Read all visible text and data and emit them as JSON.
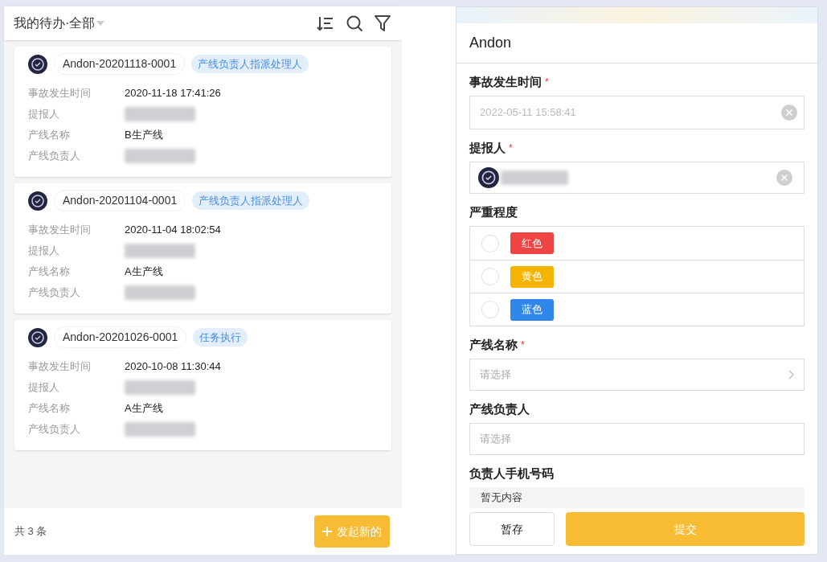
{
  "list_header": {
    "title": "我的待办·全部"
  },
  "cards": [
    {
      "id": "Andon-20201118-0001",
      "status": "产线负责人指派处理人",
      "fields": [
        {
          "label": "事故发生时间",
          "value": "2020-11-18 17:41:26"
        },
        {
          "label": "提报人",
          "redacted": true
        },
        {
          "label": "产线名称",
          "value": "B生产线"
        },
        {
          "label": "产线负责人",
          "redacted": true
        }
      ]
    },
    {
      "id": "Andon-20201104-0001",
      "status": "产线负责人指派处理人",
      "fields": [
        {
          "label": "事故发生时间",
          "value": "2020-11-04 18:02:54"
        },
        {
          "label": "提报人",
          "redacted": true
        },
        {
          "label": "产线名称",
          "value": "A生产线"
        },
        {
          "label": "产线负责人",
          "redacted": true
        }
      ]
    },
    {
      "id": "Andon-20201026-0001",
      "status": "任务执行",
      "fields": [
        {
          "label": "事故发生时间",
          "value": "2020-10-08 11:30:44"
        },
        {
          "label": "提报人",
          "redacted": true
        },
        {
          "label": "产线名称",
          "value": "A生产线"
        },
        {
          "label": "产线负责人",
          "redacted": true
        }
      ]
    }
  ],
  "footer": {
    "count": "共 3 条",
    "new_button": "发起新的"
  },
  "form": {
    "title": "Andon",
    "required_mark": "*",
    "fields": [
      {
        "kind": "datetime",
        "label": "事故发生时间",
        "required": true,
        "value": "2022-05-11 15:58:41"
      },
      {
        "kind": "user",
        "label": "提报人",
        "required": true
      },
      {
        "kind": "radio",
        "label": "严重程度",
        "required": false,
        "options": [
          {
            "label": "红色",
            "color": "#ef4444",
            "selected": false
          },
          {
            "label": "黄色",
            "color": "#f5b400",
            "selected": false
          },
          {
            "label": "蓝色",
            "color": "#2f86eb",
            "selected": false
          }
        ]
      },
      {
        "kind": "select",
        "label": "产线名称",
        "required": true,
        "placeholder": "请选择"
      },
      {
        "kind": "picker",
        "label": "产线负责人",
        "required": false,
        "placeholder": "请选择"
      },
      {
        "kind": "readonly",
        "label": "负责人手机号码",
        "required": false,
        "value": "暂无内容"
      }
    ]
  },
  "actions": {
    "save": "暂存",
    "submit": "提交"
  }
}
